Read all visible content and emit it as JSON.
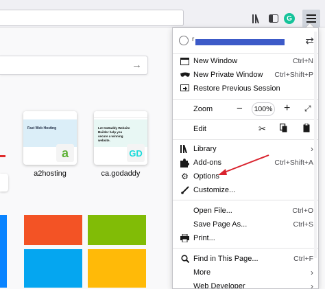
{
  "toolbar": {
    "library_icon": "library-icon",
    "sidebar_icon": "sidebar-icon",
    "grammarly_icon": "grammarly-icon",
    "grammarly_glyph": "G",
    "menu_icon": "hamburger-menu-icon"
  },
  "new_tab": {
    "search_placeholder": "",
    "top_sites": [
      {
        "label": "a2hosting",
        "thumb_heading": "Fast Web Hosting",
        "badge": "a"
      },
      {
        "label": "ca.godaddy",
        "thumb_heading": "Let GoDaddy Website Builder help you secure a winning website.",
        "badge": "GD"
      }
    ]
  },
  "menu": {
    "account": {
      "email_visible": "r"
    },
    "items": {
      "new_window": {
        "label": "New Window",
        "shortcut": "Ctrl+N"
      },
      "new_private_window": {
        "label": "New Private Window",
        "shortcut": "Ctrl+Shift+P"
      },
      "restore_session": {
        "label": "Restore Previous Session"
      },
      "zoom": {
        "label": "Zoom",
        "value": "100%",
        "minus": "−",
        "plus": "+"
      },
      "edit": {
        "label": "Edit"
      },
      "library": {
        "label": "Library"
      },
      "addons": {
        "label": "Add-ons",
        "shortcut": "Ctrl+Shift+A"
      },
      "options": {
        "label": "Options"
      },
      "customize": {
        "label": "Customize..."
      },
      "open_file": {
        "label": "Open File...",
        "shortcut": "Ctrl+O"
      },
      "save_page": {
        "label": "Save Page As...",
        "shortcut": "Ctrl+S"
      },
      "print": {
        "label": "Print..."
      },
      "find": {
        "label": "Find in This Page...",
        "shortcut": "Ctrl+F"
      },
      "more": {
        "label": "More"
      },
      "web_developer": {
        "label": "Web Developer"
      }
    }
  },
  "colors": {
    "accent_annotation": "#d9232e",
    "redaction": "#3c5ac8",
    "grammarly": "#15c39a"
  }
}
